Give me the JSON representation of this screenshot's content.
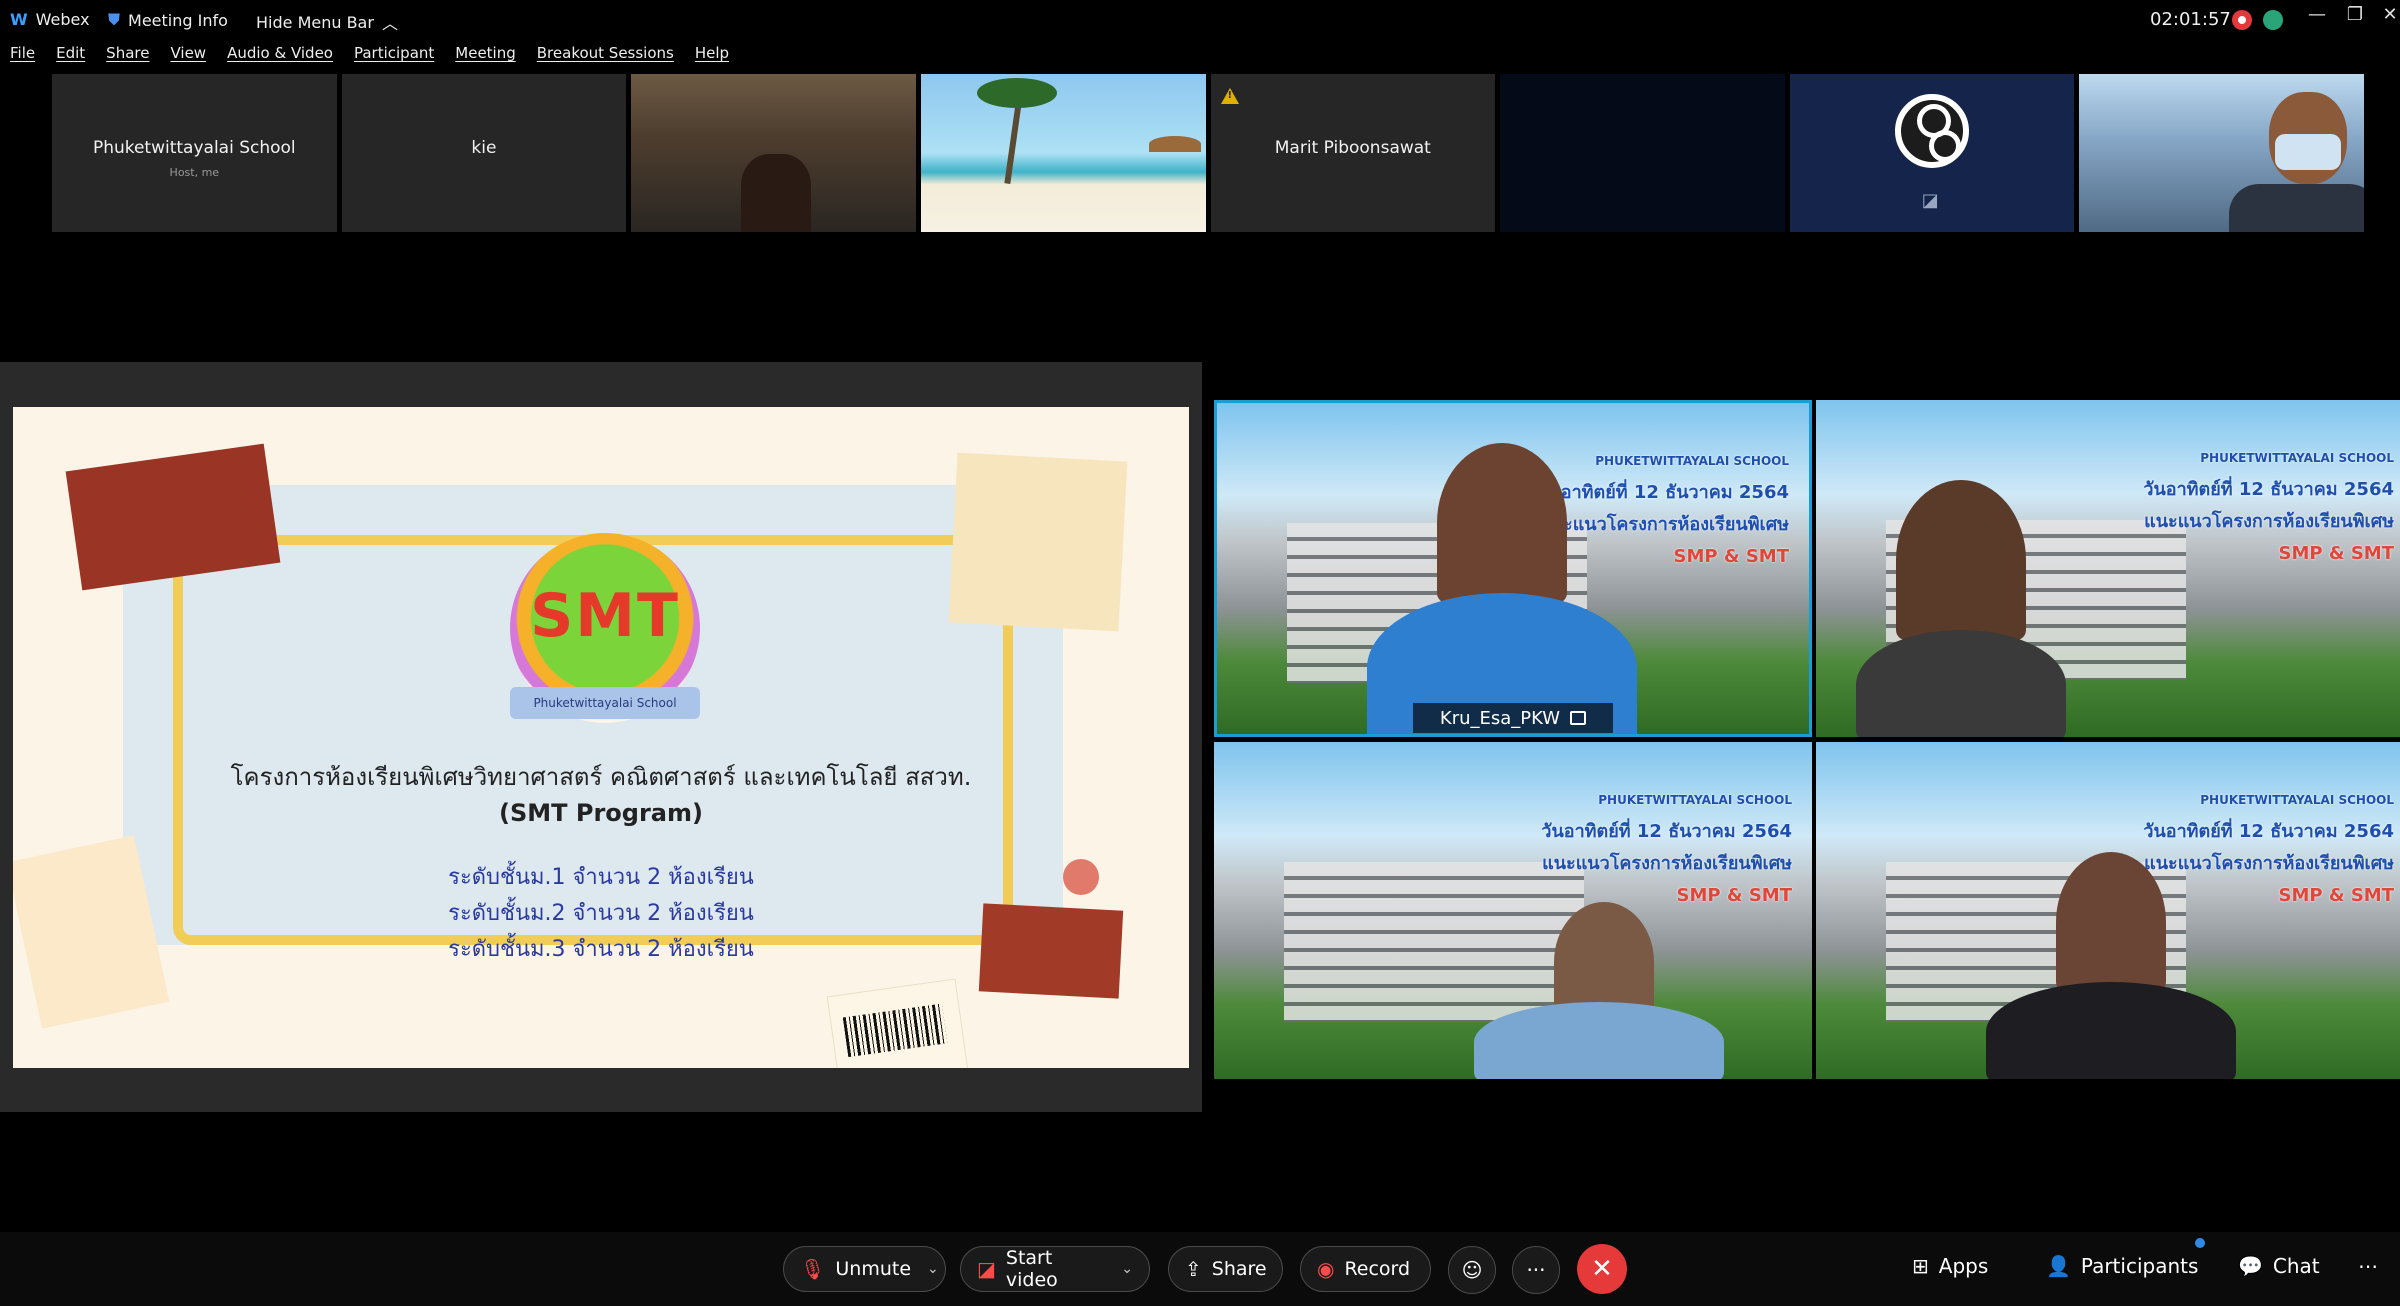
{
  "titlebar": {
    "app_name": "Webex",
    "meeting_info": "Meeting Info",
    "hide_menu": "Hide Menu Bar",
    "clock": "02:01:57",
    "minimize": "—",
    "restore": "❐",
    "close": "✕"
  },
  "menu": [
    "File",
    "Edit",
    "Share",
    "View",
    "Audio & Video",
    "Participant",
    "Meeting",
    "Breakout Sessions",
    "Help"
  ],
  "strip": {
    "tiles": [
      {
        "name": "Phuketwittayalai School",
        "sub": "Host, me"
      },
      {
        "name": "kie"
      },
      {
        "name": "Marit Piboonsawat"
      }
    ]
  },
  "slide": {
    "logo_text": "SMT",
    "logo_ribbon": "Phuketwittayalai School",
    "title": "โครงการห้องเรียนพิเศษวิทยาศาสตร์ คณิตศาสตร์ และเทคโนโลยี สสวท.",
    "subtitle": "(SMT Program)",
    "lines": [
      "ระดับชั้นม.1 จำนวน 2 ห้องเรียน",
      "ระดับชั้นม.2 จำนวน 2 ห้องเรียน",
      "ระดับชั้นม.3 จำนวน 2 ห้องเรียน"
    ]
  },
  "video_grid": {
    "banner_school": "PHUKETWITTAYALAI SCHOOL",
    "banner_date": "วันอาทิตย์ที่ 12 ธันวาคม 2564",
    "banner_guide": "แนะแนวโครงการห้องเรียนพิเศษ",
    "banner_program": "SMP & SMT",
    "active_speaker": "Kru_Esa_PKW"
  },
  "controls": {
    "unmute": "Unmute",
    "start_video": "Start video",
    "share": "Share",
    "record": "Record",
    "more": "···",
    "apps": "Apps",
    "participants": "Participants",
    "chat": "Chat"
  },
  "colors": {
    "accent_blue": "#1e9bd7",
    "leave_red": "#e5393a",
    "mute_red": "#ff4a4a"
  }
}
